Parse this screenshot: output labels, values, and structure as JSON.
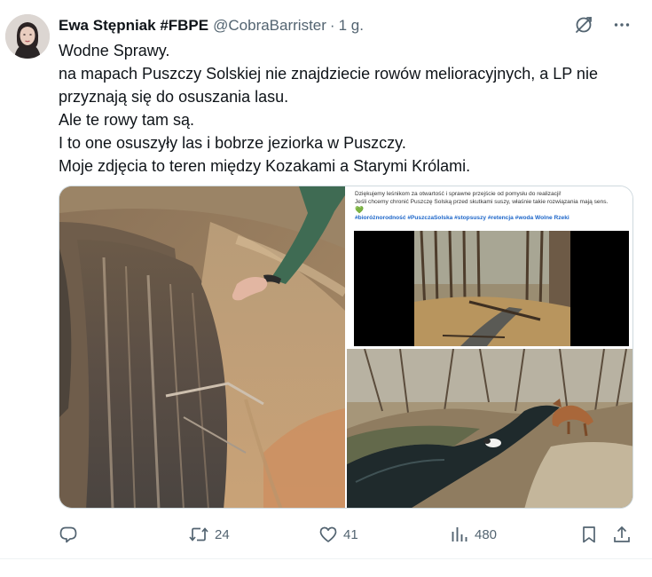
{
  "tweet": {
    "author_name": "Ewa Stępniak #FBPE",
    "author_handle": "@CobraBarrister",
    "separator": "·",
    "time": "1 g.",
    "lines": [
      "Wodne Sprawy.",
      "na mapach Puszczy Solskiej nie znajdziecie rowów melioracyjnych, a LP nie",
      "przyznają się do osuszania lasu.",
      "Ale te rowy tam są.",
      "I to one osuszyły las i bobrze jeziorka w Puszczy.",
      "Moje zdjęcia to teren między Kozakami a Starymi Królami."
    ],
    "embedded_screenshot": {
      "line1": "Dziękujemy leśnikom za otwartość i sprawne przejście od pomysłu do realizacji!",
      "line2": "Jeśli chcemy chronić Puszczę Solską przed skutkami suszy, właśnie takie rozwiązania mają sens.",
      "heart": "💚",
      "hashtags": "#bioróżnorodność #PuszczaSolska #stopsuszy #retencja #woda Wolne Rzeki"
    }
  },
  "actions": {
    "reply_count": "",
    "retweet_count": "24",
    "like_count": "41",
    "views_count": "480"
  },
  "icons": {
    "header": [
      "grok-icon",
      "more-icon"
    ],
    "actions": [
      "reply-icon",
      "retweet-icon",
      "like-icon",
      "views-icon",
      "bookmark-icon",
      "share-icon"
    ]
  },
  "colors": {
    "text": "#0f1419",
    "secondary": "#536471",
    "hashtag": "#1d66c9"
  }
}
